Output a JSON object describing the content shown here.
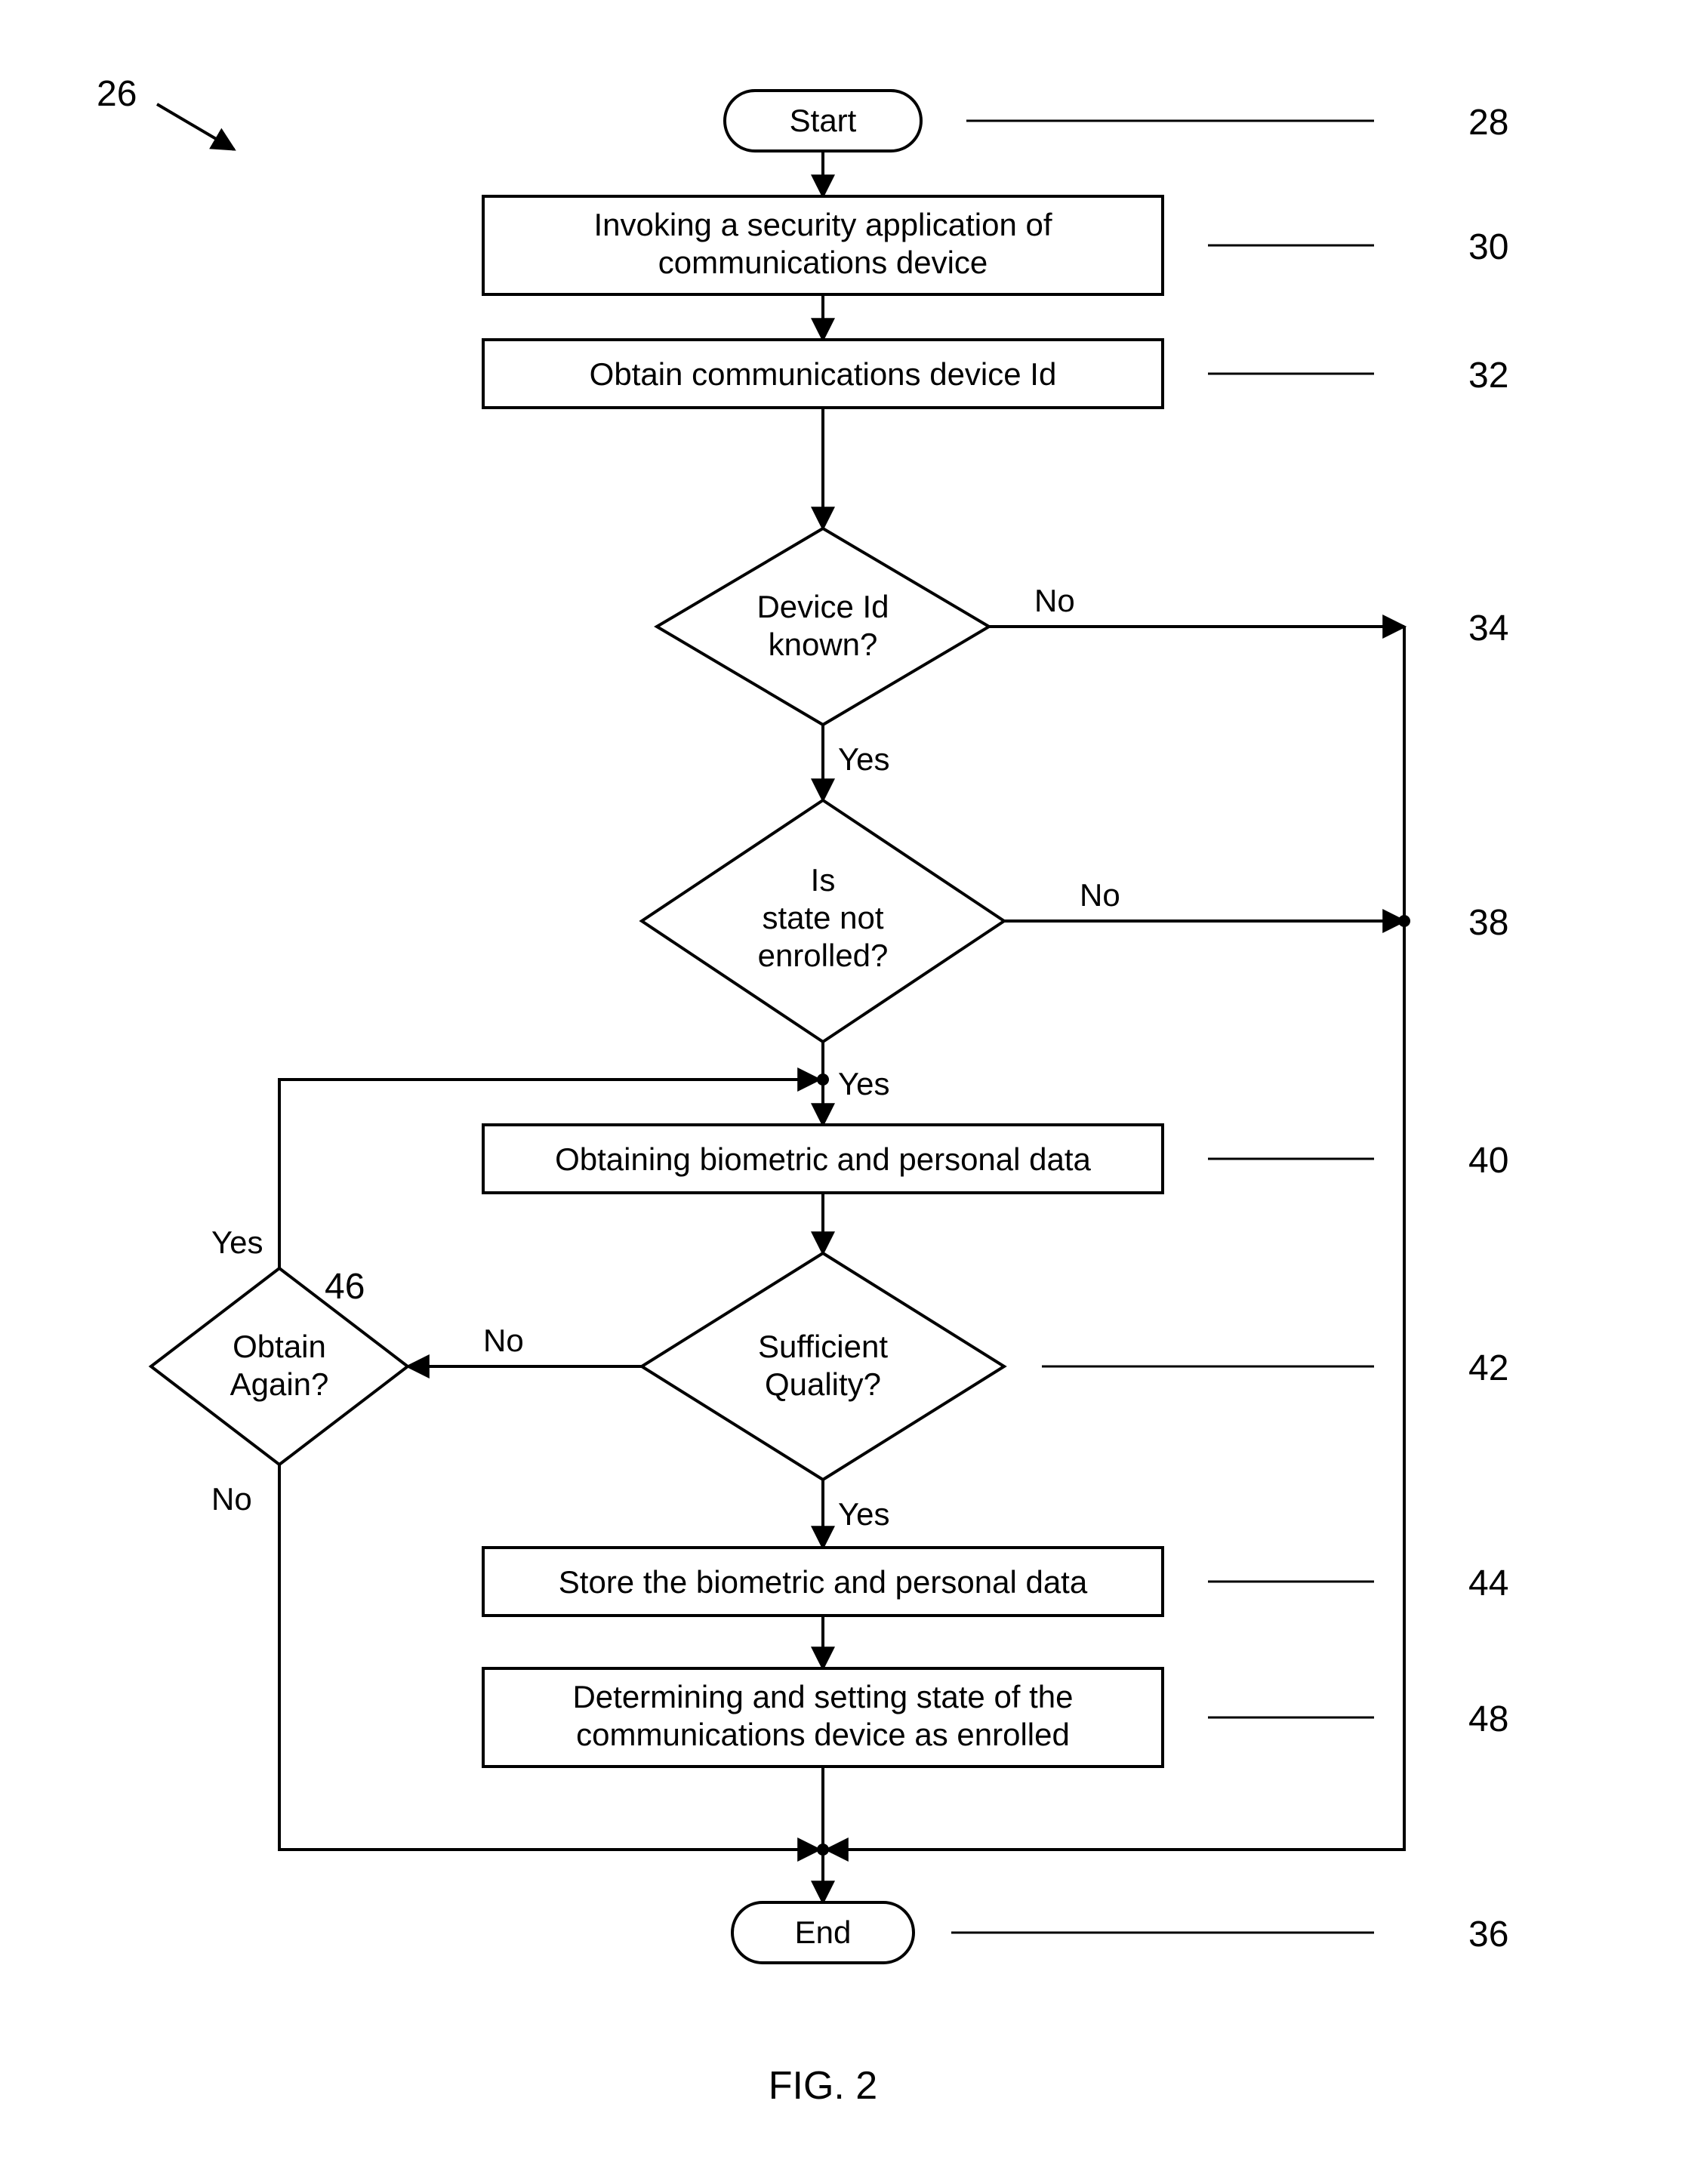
{
  "figure": {
    "number_top_left": "26",
    "caption": "FIG. 2"
  },
  "refs": {
    "r28": "28",
    "r30": "30",
    "r32": "32",
    "r34": "34",
    "r36": "36",
    "r38": "38",
    "r40": "40",
    "r42": "42",
    "r44": "44",
    "r46": "46",
    "r48": "48"
  },
  "nodes": {
    "start": "Start",
    "invoke_l1": "Invoking a security application of",
    "invoke_l2": "communications device",
    "obtain_id": "Obtain communications device Id",
    "device_id_l1": "Device Id",
    "device_id_l2": "known?",
    "state_l1": "Is",
    "state_l2": "state not",
    "state_l3": "enrolled?",
    "obtain_bio": "Obtaining biometric and personal data",
    "quality_l1": "Sufficient",
    "quality_l2": "Quality?",
    "again_l1": "Obtain",
    "again_l2": "Again?",
    "store": "Store the biometric and personal data",
    "determine_l1": "Determining and setting state of the",
    "determine_l2": "communications device as enrolled",
    "end": "End"
  },
  "edges": {
    "yes": "Yes",
    "no": "No"
  }
}
